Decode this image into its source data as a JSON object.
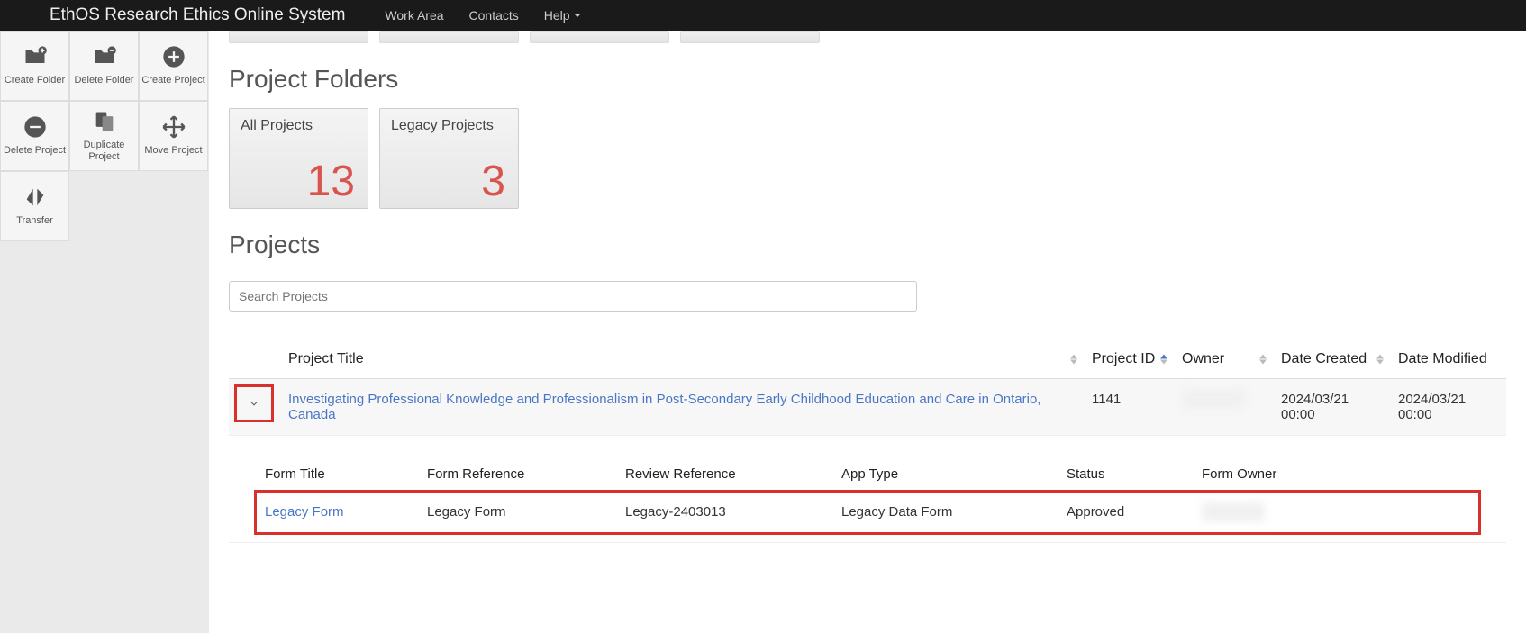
{
  "navbar": {
    "brand": "EthOS Research Ethics Online System",
    "items": [
      "Work Area",
      "Contacts",
      "Help"
    ]
  },
  "sidebar": {
    "buttons": [
      {
        "label": "Create Folder"
      },
      {
        "label": "Delete Folder"
      },
      {
        "label": "Create Project"
      },
      {
        "label": "Delete Project"
      },
      {
        "label": "Duplicate Project"
      },
      {
        "label": "Move Project"
      },
      {
        "label": "Transfer"
      }
    ]
  },
  "sections": {
    "folders_title": "Project Folders",
    "projects_title": "Projects"
  },
  "folders": [
    {
      "name": "All Projects",
      "count": "13"
    },
    {
      "name": "Legacy Projects",
      "count": "3"
    }
  ],
  "search": {
    "placeholder": "Search Projects"
  },
  "table": {
    "headers": {
      "title": "Project Title",
      "id": "Project ID",
      "owner": "Owner",
      "created": "Date Created",
      "modified": "Date Modified"
    },
    "row": {
      "title": "Investigating Professional Knowledge and Professionalism in Post-Secondary Early Childhood Education and Care in Ontario, Canada",
      "id": "1141",
      "owner": "redacted",
      "created": "2024/03/21 00:00",
      "modified": "2024/03/21 00:00"
    }
  },
  "subtable": {
    "headers": {
      "form_title": "Form Title",
      "form_ref": "Form Reference",
      "review_ref": "Review Reference",
      "app_type": "App Type",
      "status": "Status",
      "form_owner": "Form Owner"
    },
    "row": {
      "form_title": "Legacy Form",
      "form_ref": "Legacy Form",
      "review_ref": "Legacy-2403013",
      "app_type": "Legacy Data Form",
      "status": "Approved",
      "form_owner": "redacted"
    }
  }
}
